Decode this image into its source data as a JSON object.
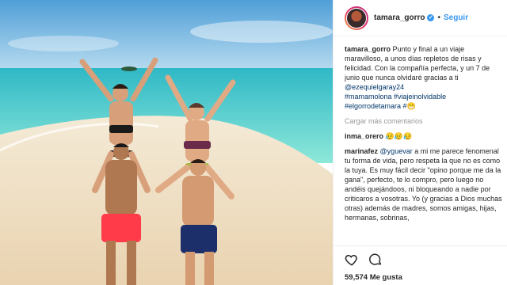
{
  "post": {
    "photo_alt": "",
    "username": "tamara_gorro",
    "follow_label": "Seguir",
    "separator": "•",
    "verified_glyph": "✓"
  },
  "caption": {
    "username": "tamara_gorro",
    "text": " Punto y final a un viaje maravilloso, a unos días repletos de risas y felicidad. Con la compañía perfecta, y un 7 de junio que nunca olvidaré gracias a ti ",
    "mention": "@ezequielgaray24",
    "hashtags": "#mamamolona #viajeinolvidable #elgorrodetamara #",
    "emoji": "😁"
  },
  "load_more": "Cargar más comentarios",
  "comments": [
    {
      "username": "inma_orero",
      "text": " 😥😥😥"
    },
    {
      "username": "marinafez",
      "mention": "@yguevar",
      "text": " a mi me parece fenomenal tu forma de vida, pero respeta la que no es como la tuya. Es muy fácil decir \"opino porque me da la gana\", perfecto, te lo compro, pero luego no andéis quejándoos, ni bloqueando a nadie por criticaros a vosotras. Yo (y gracias a Dios muchas otras) además de madres, somos amigas, hijas, hermanas, sobrinas,"
    }
  ],
  "likes": "59,574 Me gusta",
  "colors": {
    "link": "#3897f0",
    "hashtag": "#003569",
    "muted": "#999999",
    "sea": "#5fd3cf",
    "sky": "#6fb4e0",
    "sand": "#f3e3c8"
  },
  "icons": [
    "verified-icon",
    "heart-icon",
    "comment-icon"
  ]
}
